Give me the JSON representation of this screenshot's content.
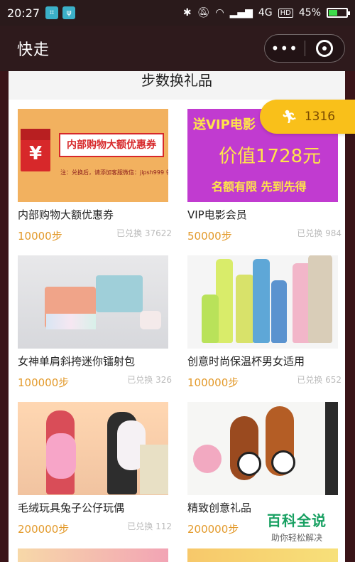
{
  "status_bar": {
    "time": "20:27",
    "network": "4G",
    "hd": "HD",
    "battery": "45%",
    "battery_level": 0.45
  },
  "title_bar": {
    "title": "快走",
    "more_label": "•••"
  },
  "page": {
    "section_title": "步数换礼品"
  },
  "steps_badge": {
    "count": "1316",
    "color": "#f9c01a"
  },
  "products": [
    {
      "name": "内部购物大额优惠券",
      "price": "10000步",
      "sold": "已兑换 37622",
      "thumb_text": "内部购物大额优惠券",
      "thumb_note": "注：兑换后，请添加客服微信：jipsh999 领取"
    },
    {
      "name": "VIP电影会员",
      "price": "50000步",
      "sold": "已兑换 984",
      "thumb_line1": "送VIP电影",
      "thumb_line2": "价值1728元",
      "thumb_line3": "名额有限 先到先得"
    },
    {
      "name": "女神单肩斜挎迷你镭射包",
      "price": "100000步",
      "sold": "已兑换 326"
    },
    {
      "name": "创意时尚保温杯男女适用",
      "price": "100000步",
      "sold": "已兑换 652"
    },
    {
      "name": "毛绒玩具兔子公仔玩偶",
      "price": "200000步",
      "sold": "已兑换 112"
    },
    {
      "name": "精致创意礼品",
      "price": "200000步",
      "sold": ""
    }
  ],
  "watermark": {
    "title": "百科全说",
    "subtitle": "助你轻松解决"
  },
  "colors": {
    "price": "#e39a2b",
    "header_bg": "#2e1a1c",
    "accent_green": "#17a061"
  }
}
